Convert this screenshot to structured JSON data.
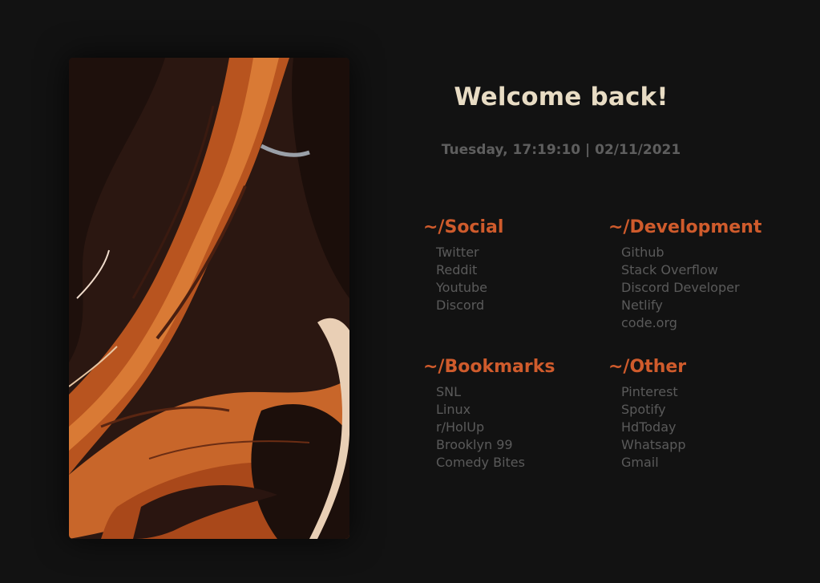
{
  "greeting": "Welcome back!",
  "datetime": "Tuesday, 17:19:10 | 02/11/2021",
  "accent_color": "#cf5b2c",
  "artwork": {
    "icon": "abstract-marble-artwork"
  },
  "groups": [
    {
      "title": "~/Social",
      "links": [
        "Twitter",
        "Reddit",
        "Youtube",
        "Discord"
      ]
    },
    {
      "title": "~/Development",
      "links": [
        "Github",
        "Stack Overflow",
        "Discord Developer",
        "Netlify",
        "code.org"
      ]
    },
    {
      "title": "~/Bookmarks",
      "links": [
        "SNL",
        "Linux",
        "r/HolUp",
        "Brooklyn 99",
        "Comedy Bites"
      ]
    },
    {
      "title": "~/Other",
      "links": [
        "Pinterest",
        "Spotify",
        "HdToday",
        "Whatsapp",
        "Gmail"
      ]
    }
  ]
}
